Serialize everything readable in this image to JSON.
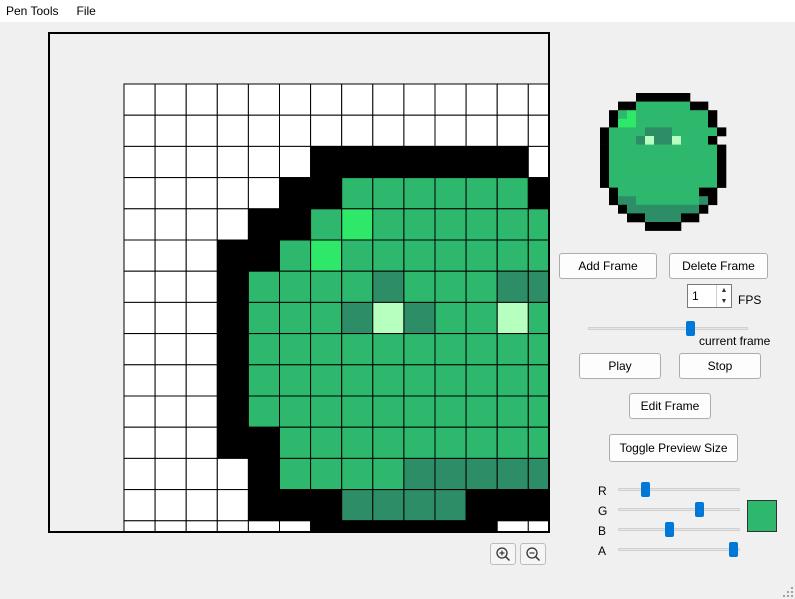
{
  "menu": {
    "items": [
      "Pen Tools",
      "File"
    ]
  },
  "canvas": {
    "colors": {
      ".": "#f0f0f0",
      "w": "#ffffff",
      "k": "#000000",
      "g": "#2db86d",
      "d": "#2d8d66",
      "l": "#2ee86a",
      "e": "#b6ffbf"
    },
    "rows": [
      "wwwwwwwwwwwwww",
      "wwwwwwwwwwwwww",
      "wwwwwwkkkkkkkw",
      "wwwwwkkggggggk",
      "wwwwkkglgggggg",
      "wwwkkglggggggg",
      "wwwkggggdgggdd",
      "wwwkgggdedggeg",
      "wwwkgggggggggg",
      "wwwkgggggggggg",
      "wwwkgggggggggg",
      "wwwkkggggggggg",
      "wwwwkggggddddd",
      "wwwwkkkddddkkk",
      "wwwwwwkkkkkkww"
    ]
  },
  "preview": {
    "rows": [
      "....kkkkkk....",
      "..kkggggggkk..",
      ".kglggggggggk.",
      ".kllggggggggk.",
      "kggggdddgggggk",
      "kgggdeddegggk.",
      "kggggggggggggk",
      "kggggggggggggk",
      "kggggggggggggk",
      "kggggggggggggk",
      "kggggggggggggk",
      ".kgggggggggkk.",
      ".kddgggggggdk.",
      "..kddddddddk..",
      "...kkddddkk...",
      ".....kkkk....."
    ]
  },
  "frames": {
    "add_label": "Add Frame",
    "delete_label": "Delete Frame",
    "fps_value": "1",
    "fps_label": "FPS",
    "current_frame_label": "current frame",
    "current_frame_level": 0.65,
    "play_label": "Play",
    "stop_label": "Stop",
    "edit_label": "Edit Frame",
    "toggle_preview_label": "Toggle Preview Size"
  },
  "color_picker": {
    "r_label": "R",
    "g_label": "G",
    "b_label": "B",
    "a_label": "A",
    "r_level": 0.2,
    "g_level": 0.68,
    "b_level": 0.42,
    "a_level": 0.98,
    "current_color": "#2db86d"
  },
  "icons": {
    "zoom_in": "zoom-in-icon",
    "zoom_out": "zoom-out-icon"
  }
}
